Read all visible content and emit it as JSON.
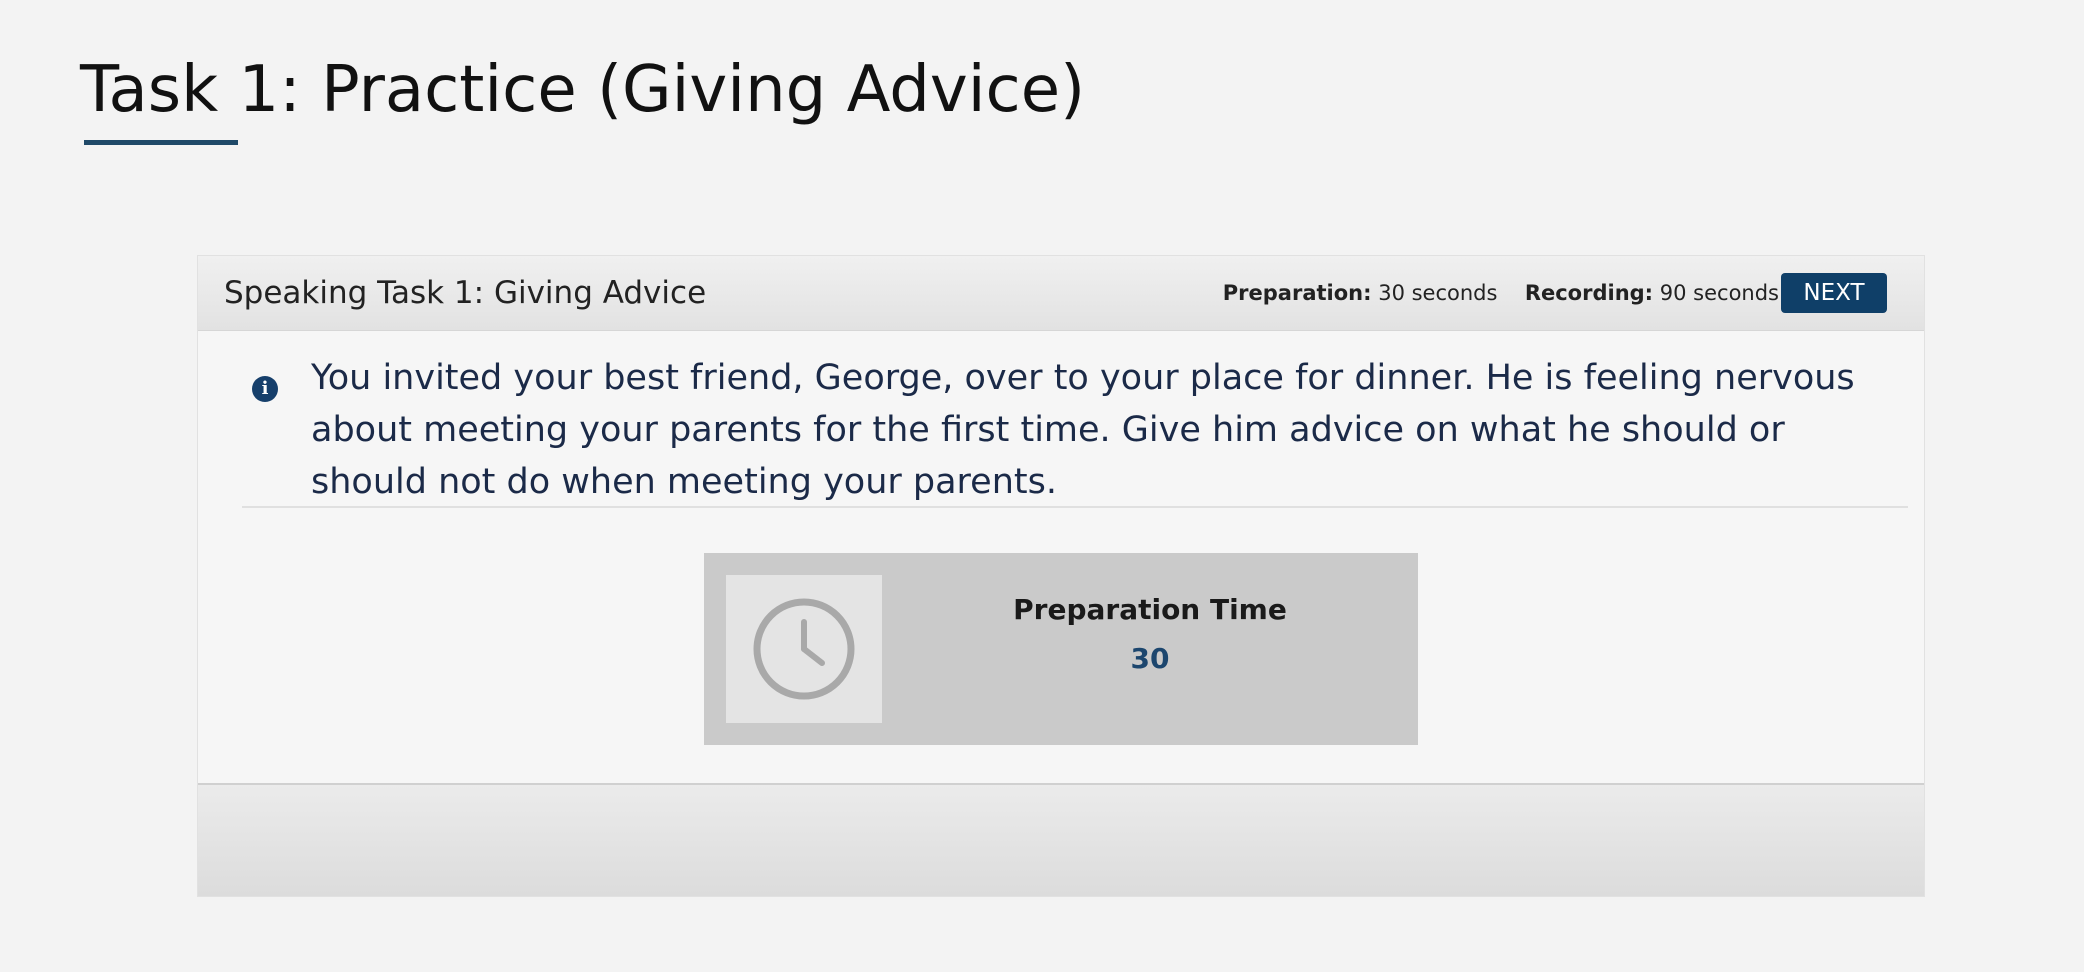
{
  "slide": {
    "title": "Task 1: Practice (Giving Advice)"
  },
  "panel": {
    "task_label": "Speaking Task 1: Giving Advice",
    "preparation_label": "Preparation:",
    "preparation_value": "30 seconds",
    "recording_label": "Recording:",
    "recording_value": "90 seconds",
    "next_label": "NEXT",
    "info_icon": "i",
    "prompt": "You invited your best friend, George, over to your place for dinner. He is feeling nervous about meeting your parents for the first time. Give him advice on what he should or should not do when meeting your parents.",
    "timer": {
      "label": "Preparation Time",
      "value": "30"
    }
  },
  "icons": {
    "info": "info-icon",
    "clock": "clock-icon"
  },
  "colors": {
    "accent": "#0f3f68",
    "prompt_text": "#1b2a48",
    "timer_value": "#1c466e",
    "timer_box": "#cacaca"
  }
}
